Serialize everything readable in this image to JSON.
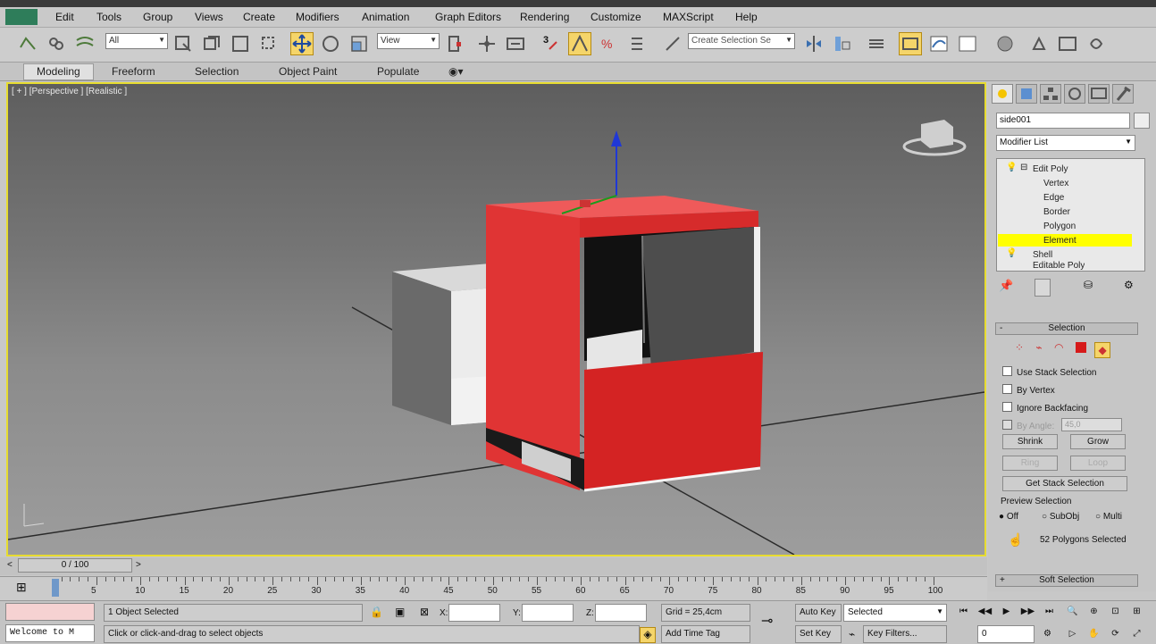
{
  "menu": [
    "Edit",
    "Tools",
    "Group",
    "Views",
    "Create",
    "Modifiers",
    "Animation",
    "Graph Editors",
    "Rendering",
    "Customize",
    "MAXScript",
    "Help"
  ],
  "toolbar": {
    "selection_filter": "All",
    "ref_coord": "View",
    "named_selection_placeholder": "Create Selection Se",
    "snap_number": "3"
  },
  "ribbon": {
    "tabs": [
      "Modeling",
      "Freeform",
      "Selection",
      "Object Paint",
      "Populate"
    ],
    "active": "Modeling"
  },
  "viewport": {
    "label": "[ + ] [Perspective ] [Realistic ]"
  },
  "command_panel": {
    "object_name": "side001",
    "modifier_list": "Modifier List",
    "stack": {
      "edit_poly": "Edit Poly",
      "vertex": "Vertex",
      "edge": "Edge",
      "border": "Border",
      "polygon": "Polygon",
      "element": "Element",
      "shell": "Shell",
      "editable_poly": "Editable Poly"
    },
    "selection_rollout": {
      "title": "Selection",
      "use_stack_selection": "Use Stack Selection",
      "by_vertex": "By Vertex",
      "ignore_backfacing": "Ignore Backfacing",
      "angle_value": "45,0",
      "by_angle": "By Angle:",
      "shrink": "Shrink",
      "grow": "Grow",
      "ring": "Ring",
      "loop": "Loop",
      "get_stack_selection": "Get Stack Selection",
      "preview_selection": "Preview Selection",
      "preview_off": "Off",
      "preview_subobj": "SubObj",
      "preview_multi": "Multi",
      "status": "52 Polygons Selected"
    },
    "soft_selection": "Soft Selection",
    "colors": {
      "selected_stack": "#ffff00",
      "active_tool": "#f5d56a"
    }
  },
  "timeline": {
    "frame_counter": "0 / 100",
    "ticks": [
      "5",
      "10",
      "15",
      "20",
      "25",
      "30",
      "35",
      "40",
      "45",
      "50",
      "55",
      "60",
      "65",
      "70",
      "75",
      "80",
      "85",
      "90",
      "95",
      "100"
    ]
  },
  "status": {
    "maxscript_listener": "Welcome to M",
    "objects_selected": "1 Object Selected",
    "prompt": "Click or click-and-drag to select objects",
    "x_label": "X:",
    "y_label": "Y:",
    "z_label": "Z:",
    "grid": "Grid = 25,4cm",
    "add_time_tag": "Add Time Tag",
    "auto_key": "Auto Key",
    "set_key": "Set Key",
    "key_mode": "Selected",
    "key_filters": "Key Filters...",
    "current_frame": "0"
  }
}
